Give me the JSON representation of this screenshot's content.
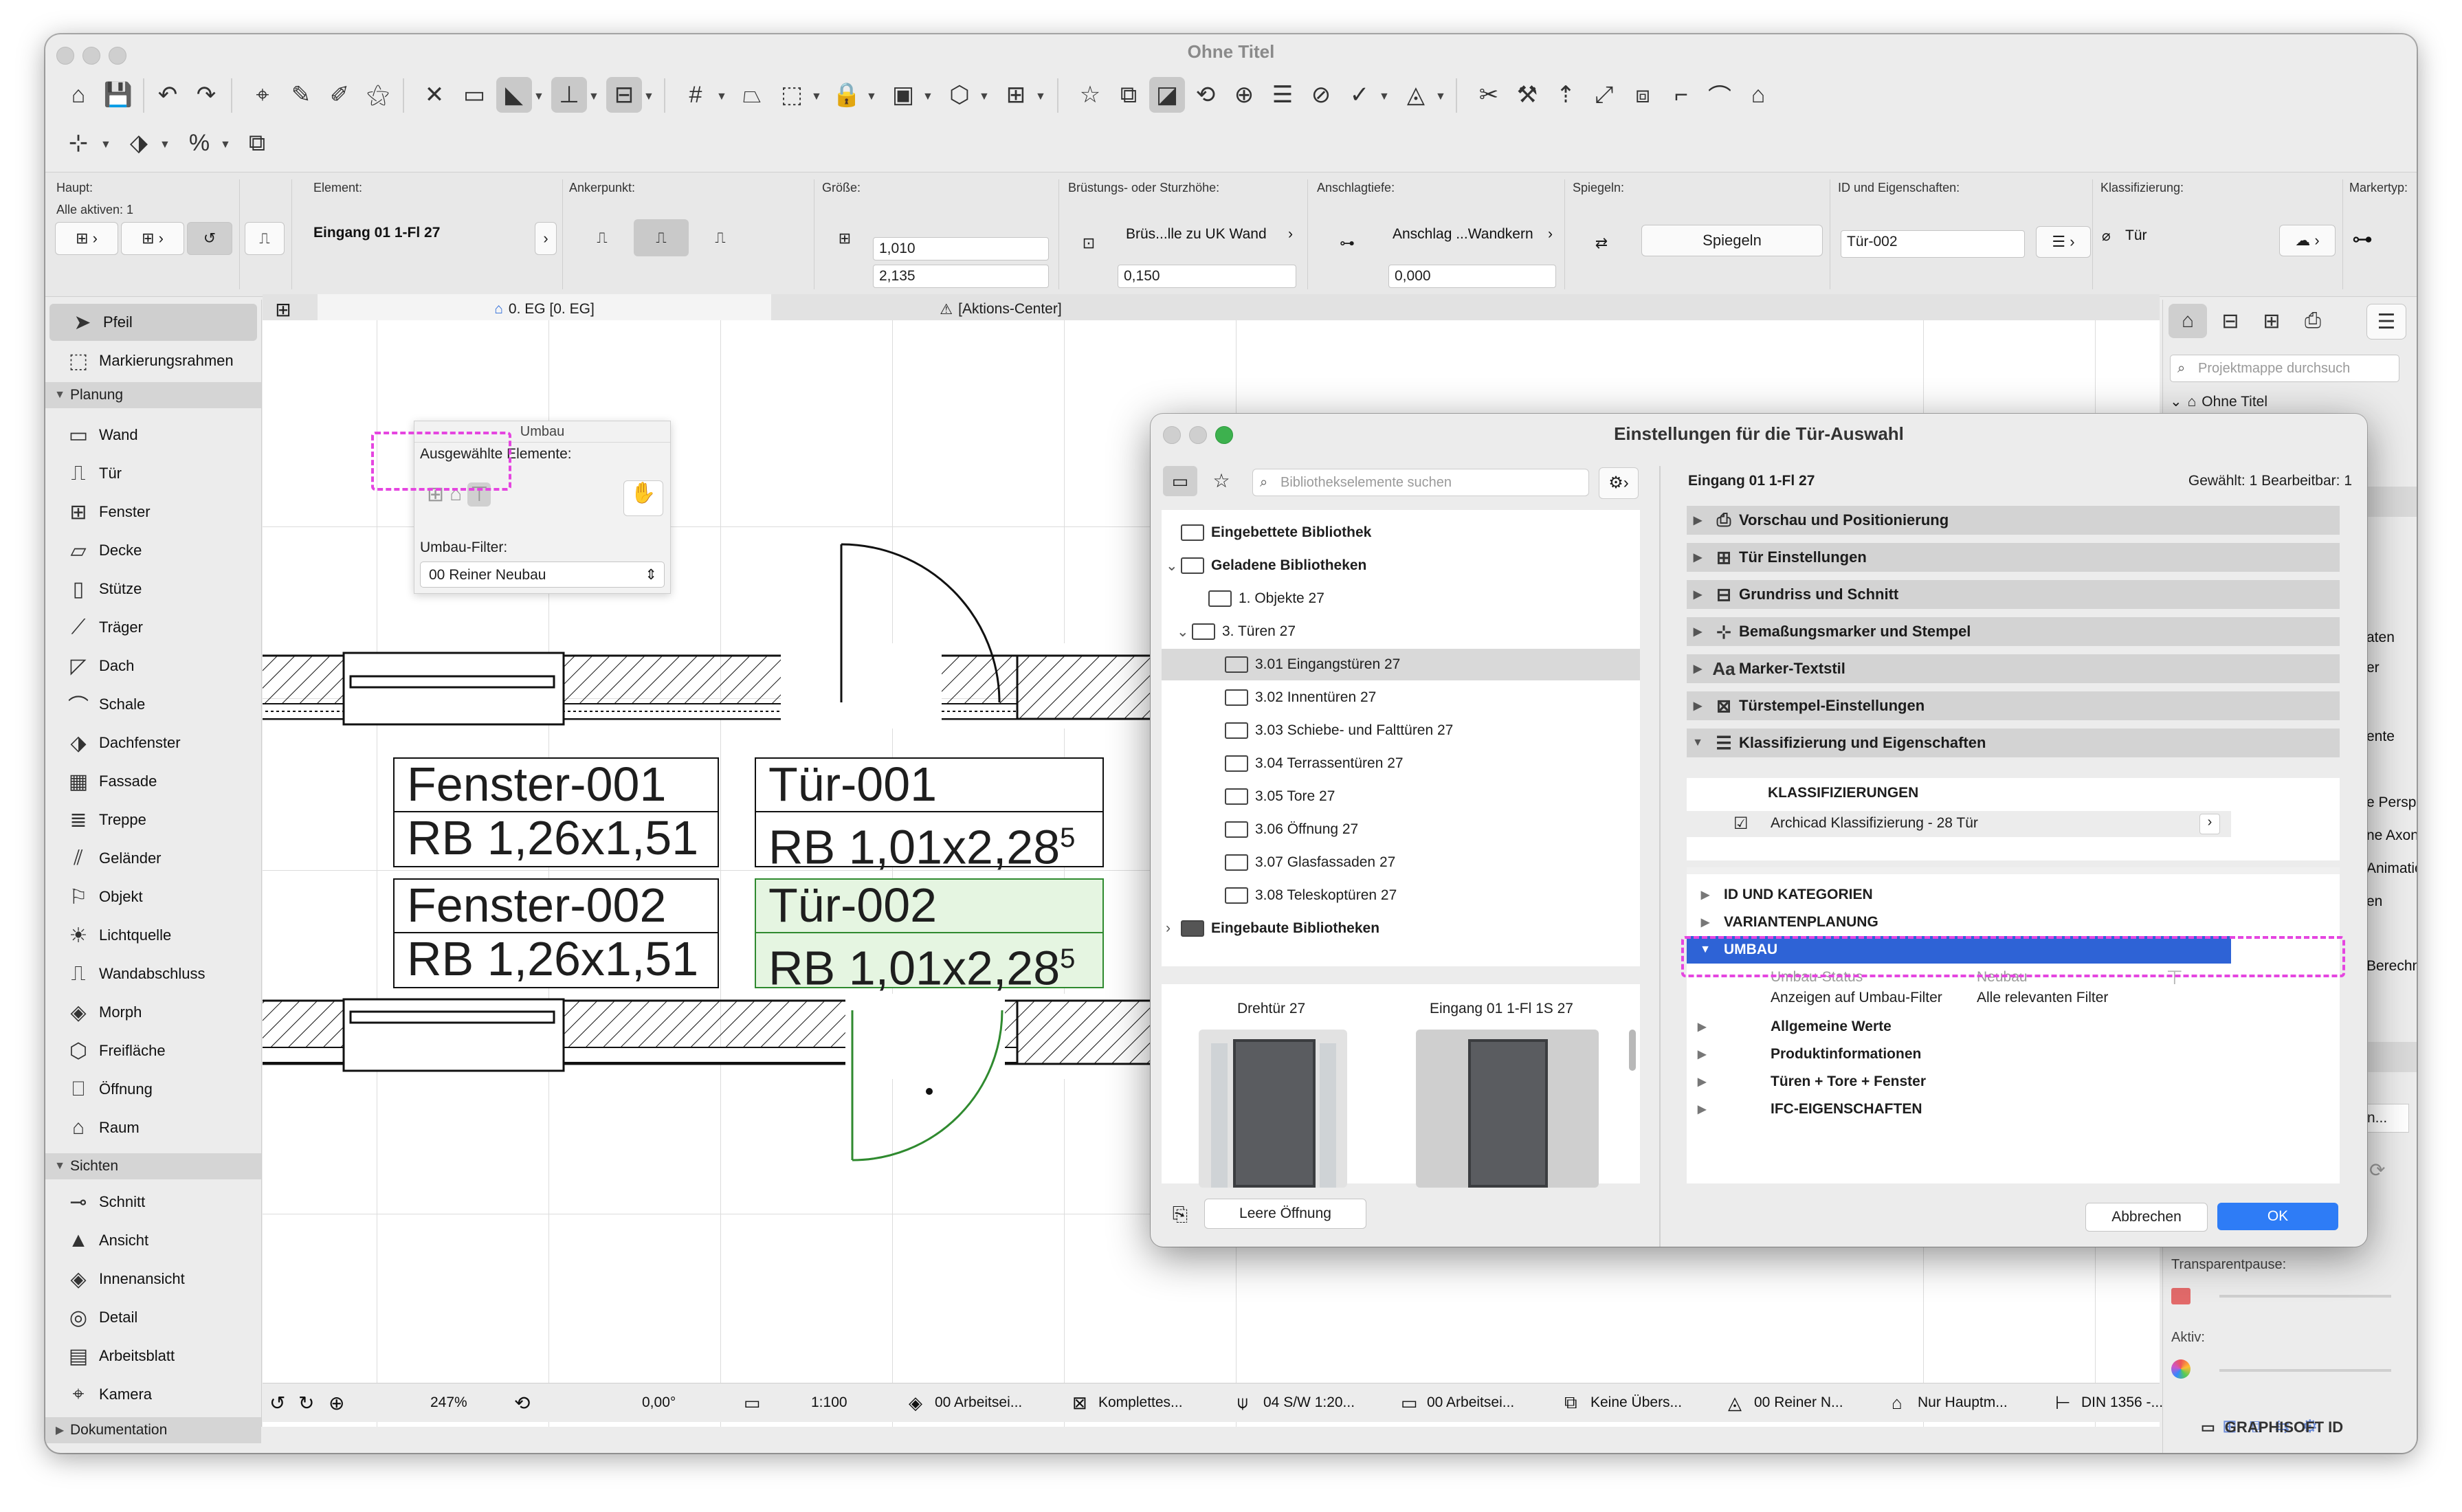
{
  "window": {
    "title": "Ohne Titel"
  },
  "infobox": {
    "haupt_label": "Haupt:",
    "alle_aktiven": "Alle aktiven: 1",
    "element_label": "Element:",
    "element_value": "Eingang 01 1-Fl 27",
    "ankerpunkt_label": "Ankerpunkt:",
    "groesse_label": "Größe:",
    "width": "1,010",
    "height": "2,135",
    "bruestung_label": "Brüstungs- oder Sturzhöhe:",
    "bruestung_mode": "Brüs...lle zu UK Wand",
    "bruestung_value": "0,150",
    "anschlag_label": "Anschlagtiefe:",
    "anschlag_mode": "Anschlag ...Wandkern",
    "anschlag_value": "0,000",
    "spiegeln_label": "Spiegeln:",
    "spiegeln_button": "Spiegeln",
    "id_label": "ID und Eigenschaften:",
    "id_value": "Tür-002",
    "klass_label": "Klassifizierung:",
    "klass_value": "Tür",
    "markertyp_label": "Markertyp:"
  },
  "tabs": {
    "view1": "0. EG [0. EG]",
    "view2": "[Aktions-Center]"
  },
  "toolbox": {
    "pfeil": "Pfeil",
    "markierungsrahmen": "Markierungsrahmen",
    "planung": "Planung",
    "planung_tools": [
      "Wand",
      "Tür",
      "Fenster",
      "Decke",
      "Stütze",
      "Träger",
      "Dach",
      "Schale",
      "Dachfenster",
      "Fassade",
      "Treppe",
      "Geländer",
      "Objekt",
      "Lichtquelle",
      "Wandabschluss",
      "Morph",
      "Freifläche",
      "Öffnung",
      "Raum"
    ],
    "sichten": "Sichten",
    "sichten_tools": [
      "Schnitt",
      "Ansicht",
      "Innenansicht",
      "Detail",
      "Arbeitsblatt",
      "Kamera"
    ],
    "dokumentation": "Dokumentation"
  },
  "umbau_palette": {
    "title": "Umbau",
    "selected_label": "Ausgewählte Elemente:",
    "filter_label": "Umbau-Filter:",
    "filter_value": "00 Reiner Neubau"
  },
  "labels": [
    {
      "id": "Fenster-001",
      "dim": "RB  1,26x1,51",
      "sup": ""
    },
    {
      "id": "Tür-001",
      "dim": "RB  1,01x2,28",
      "sup": "5"
    },
    {
      "id": "Fenster-002",
      "dim": "RB  1,26x1,51",
      "sup": ""
    },
    {
      "id": "Tür-002",
      "dim": "RB  1,01x2,28",
      "sup": "5"
    }
  ],
  "dialog": {
    "title": "Einstellungen für die Tür-Auswahl",
    "search_placeholder": "Bibliothekselemente suchen",
    "tree": [
      {
        "label": "Eingebettete Bibliothek",
        "bold": true
      },
      {
        "label": "Geladene Bibliotheken",
        "bold": true
      },
      {
        "label": "1. Objekte 27",
        "bold": false
      },
      {
        "label": "3. Türen 27",
        "bold": false
      },
      {
        "label": "3.01 Eingangstüren 27",
        "bold": false
      },
      {
        "label": "3.02 Innentüren 27",
        "bold": false
      },
      {
        "label": "3.03 Schiebe- und Falttüren 27",
        "bold": false
      },
      {
        "label": "3.04 Terrassentüren 27",
        "bold": false
      },
      {
        "label": "3.05 Tore 27",
        "bold": false
      },
      {
        "label": "3.06 Öffnung 27",
        "bold": false
      },
      {
        "label": "3.07 Glasfassaden 27",
        "bold": false
      },
      {
        "label": "3.08 Teleskoptüren 27",
        "bold": false
      },
      {
        "label": "Eingebaute Bibliotheken",
        "bold": true
      }
    ],
    "preview1": "Drehtür 27",
    "preview2": "Eingang 01 1-Fl 1S 27",
    "leere_oeffnung": "Leere Öffnung",
    "element_name": "Eingang 01 1-Fl 27",
    "selection_info": "Gewählt: 1 Bearbeitbar: 1",
    "sections": [
      "Vorschau und Positionierung",
      "Tür Einstellungen",
      "Grundriss und Schnitt",
      "Bemaßungsmarker und Stempel",
      "Marker-Textstil",
      "Türstempel-Einstellungen",
      "Klassifizierung und Eigenschaften"
    ],
    "klassifizierungen": "KLASSIFIZIERUNGEN",
    "klass_system": "Archicad Klassifizierung - 28 Tür",
    "props": {
      "id_kat": "ID UND KATEGORIEN",
      "varianten": "VARIANTENPLANUNG",
      "umbau": "UMBAU",
      "umbau_status_label": "Umbau-Status",
      "umbau_status_value": "Neubau",
      "anzeigen_label": "Anzeigen auf Umbau-Filter",
      "anzeigen_value": "Alle relevanten Filter",
      "allgemein": "Allgemeine Werte",
      "produkt": "Produktinformationen",
      "tueren": "Türen + Tore + Fenster",
      "ifc": "IFC-EIGENSCHAFTEN"
    },
    "cancel": "Abbrechen",
    "ok": "OK"
  },
  "right_panel": {
    "search_placeholder": "Projektmappe durchsuch",
    "project": "Ohne Titel",
    "partials": [
      "aten",
      "er",
      "ente",
      "e Perspek",
      "ne Axonom",
      "Animation",
      "en",
      "Berechnung",
      "n..."
    ],
    "transparent": "Transparentpause:",
    "aktiv": "Aktiv:",
    "graphisoft": "GRAPHISOFT ID"
  },
  "statusbar": {
    "zoom": "247%",
    "angle": "0,00°",
    "scale": "1:100",
    "layer": "00 Arbeitsei...",
    "model": "Komplettes...",
    "pen": "04 S/W 1:20...",
    "layer2": "00 Arbeitsei...",
    "override": "Keine Übers...",
    "renovation": "00 Reiner N...",
    "structure": "Nur Hauptm...",
    "dimension": "DIN 1356 -..."
  },
  "colors": {
    "accent": "#1f5fd6",
    "highlight": "#e545e0",
    "selection": "#2f8a2f"
  }
}
